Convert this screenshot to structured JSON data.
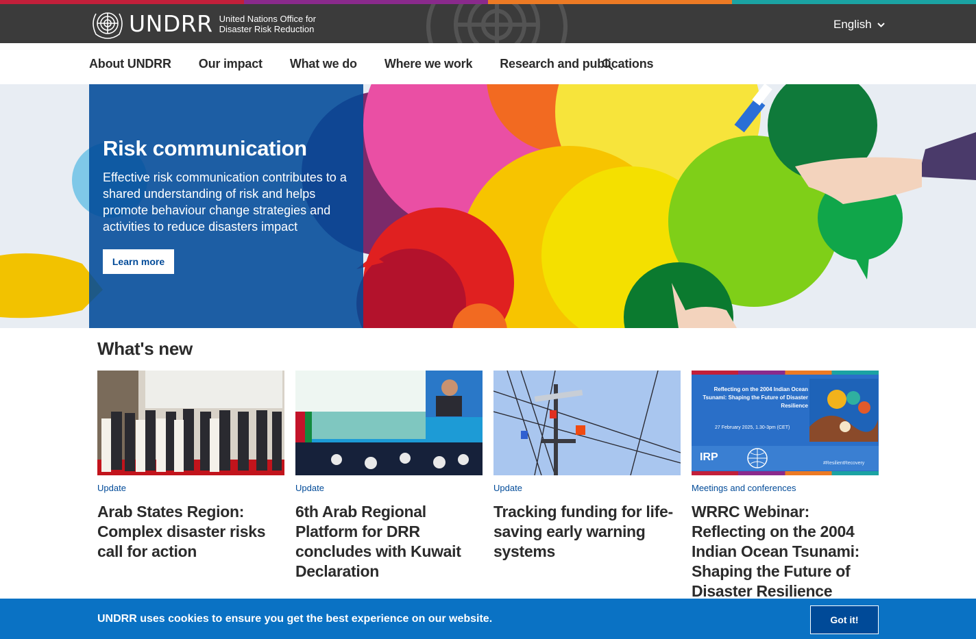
{
  "colors": {
    "stripe": [
      "#c21f3a",
      "#8a2a8c",
      "#ec7a24",
      "#1ba3a3"
    ],
    "header_bg": "#3b3b3b",
    "hero_panel": "#004a98",
    "link_blue": "#004a98",
    "cookie_bg": "#0a72c4"
  },
  "header": {
    "logo_acronym": "UNDRR",
    "logo_subtitle": "United Nations Office for Disaster Risk Reduction",
    "emblem_icon": "un-emblem-icon",
    "language": "English"
  },
  "nav": {
    "items": [
      "About UNDRR",
      "Our impact",
      "What we do",
      "Where we work",
      "Research and publications"
    ],
    "search_icon": "search-icon"
  },
  "hero": {
    "title": "Risk communication",
    "text": "Effective risk communication contributes to a shared understanding of risk and helps promote behaviour change strategies and activities to reduce disasters impact",
    "button": "Learn more"
  },
  "whats_new": {
    "title": "What's new",
    "cards": [
      {
        "tag": "Update",
        "title": "Arab States Region: Complex disaster risks call for action"
      },
      {
        "tag": "Update",
        "title": "6th Arab Regional Platform for DRR concludes with Kuwait Declaration"
      },
      {
        "tag": "Update",
        "title": "Tracking funding for life-saving early warning systems"
      },
      {
        "tag": "Meetings and conferences",
        "title": "WRRC Webinar: Reflecting on the 2004 Indian Ocean Tsunami: Shaping the Future of Disaster Resilience"
      }
    ],
    "card4_image": {
      "heading": "Reflecting on the 2004 Indian Ocean Tsunami: Shaping the Future of Disaster Resilience",
      "date": "27 February 2025, 1.30-3pm (CET)",
      "org": "IRP",
      "hashtag": "#ResilientRecovery"
    }
  },
  "cookie": {
    "message": "UNDRR uses cookies to ensure you get the best experience on our website.",
    "button": "Got it!"
  }
}
